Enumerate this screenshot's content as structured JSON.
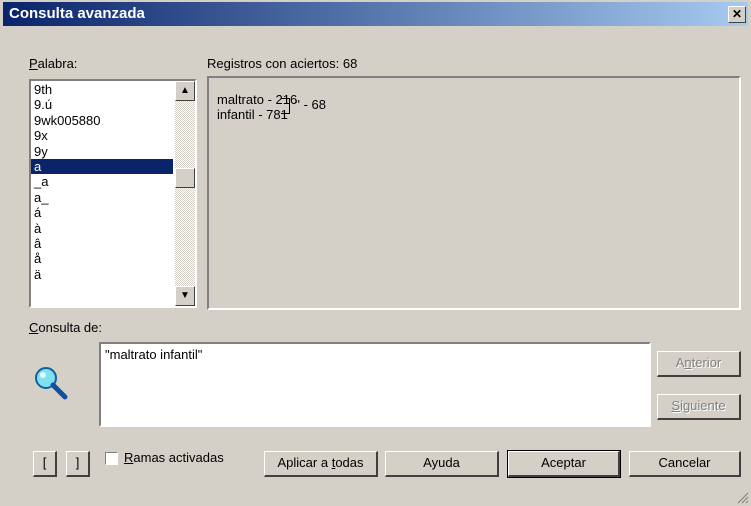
{
  "window": {
    "title": "Consulta avanzada",
    "close": "✕"
  },
  "palabra": {
    "label_u": "P",
    "label_rest": "alabra:",
    "items": [
      "9th",
      "9.ú",
      "9wk005880",
      "9x",
      "9y",
      "a",
      "_a",
      "a_",
      "á",
      "à",
      "â",
      "å",
      "ä"
    ],
    "selected": "a"
  },
  "results": {
    "header": "Registros con aciertos: 68",
    "line1": "maltrato - 216",
    "line2": "infantil - 781",
    "combined": "'' - 68"
  },
  "consulta": {
    "label_u": "C",
    "label_rest": "onsulta de:",
    "value": "\"maltrato infantil\""
  },
  "buttons": {
    "anterior_a": "A",
    "anterior_u": "n",
    "anterior_rest": "terior",
    "siguiente_u": "S",
    "siguiente_rest": "iguiente",
    "open_bracket": "[",
    "close_bracket": "]",
    "ramas_u": "R",
    "ramas_rest": "amas activadas",
    "aplicar_a": "Aplicar a ",
    "aplicar_u": "t",
    "aplicar_rest": "odas",
    "ayuda": "Ayuda",
    "aceptar": "Aceptar",
    "cancelar": "Cancelar"
  },
  "icons": {
    "search": "magnifier-icon",
    "scroll_up": "arrow-up-icon",
    "scroll_down": "arrow-down-icon",
    "grip": "resize-grip-icon"
  }
}
